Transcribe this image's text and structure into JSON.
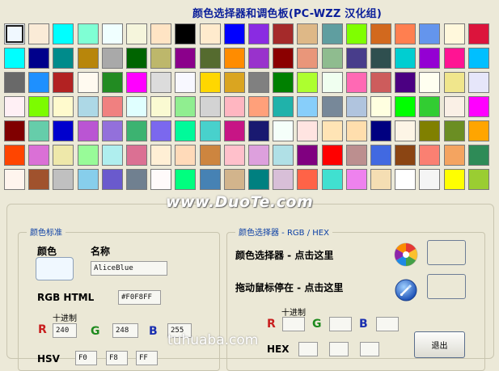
{
  "title": "颜色选择器和调色板(PC-WZZ 汉化组)",
  "watermark": "www.DuoTe.com",
  "corner_watermark": "tuhuaba.com",
  "palette": [
    [
      "#f0f8ff",
      "#faebd7",
      "#00ffff",
      "#7fffd4",
      "#f0ffff",
      "#f5f5dc",
      "#ffe4c4",
      "#000000",
      "#ffebcd",
      "#0000ff",
      "#8a2be2",
      "#a52a2a",
      "#deb887",
      "#5f9ea0",
      "#7fff00",
      "#d2691e",
      "#ff7f50",
      "#6495ed",
      "#fff8dc",
      "#dc143c"
    ],
    [
      "#00ffff",
      "#00008b",
      "#008b8b",
      "#b8860b",
      "#a9a9a9",
      "#006400",
      "#bdb76b",
      "#8b008b",
      "#556b2f",
      "#ff8c00",
      "#9932cc",
      "#8b0000",
      "#e9967a",
      "#8fbc8f",
      "#483d8b",
      "#2f4f4f",
      "#00ced1",
      "#9400d3",
      "#ff1493",
      "#00bfff"
    ],
    [
      "#696969",
      "#1e90ff",
      "#b22222",
      "#fffaf0",
      "#228b22",
      "#ff00ff",
      "#dcdcdc",
      "#f8f8ff",
      "#ffd700",
      "#daa520",
      "#808080",
      "#008000",
      "#adff2f",
      "#f0fff0",
      "#ff69b4",
      "#cd5c5c",
      "#4b0082",
      "#fffff0",
      "#f0e68c",
      "#e6e6fa"
    ],
    [
      "#fff0f5",
      "#7cfc00",
      "#fffacd",
      "#add8e6",
      "#f08080",
      "#e0ffff",
      "#fafad2",
      "#90ee90",
      "#d3d3d3",
      "#ffb6c1",
      "#ffa07a",
      "#20b2aa",
      "#87cefa",
      "#778899",
      "#b0c4de",
      "#ffffe0",
      "#00ff00",
      "#32cd32",
      "#faf0e6",
      "#ff00ff"
    ],
    [
      "#800000",
      "#66cdaa",
      "#0000cd",
      "#ba55d3",
      "#9370db",
      "#3cb371",
      "#7b68ee",
      "#00fa9a",
      "#48d1cc",
      "#c71585",
      "#191970",
      "#f5fffa",
      "#ffe4e1",
      "#ffe4b5",
      "#ffdead",
      "#000080",
      "#fdf5e6",
      "#808000",
      "#6b8e23",
      "#ffa500"
    ],
    [
      "#ff4500",
      "#da70d6",
      "#eee8aa",
      "#98fb98",
      "#afeeee",
      "#db7093",
      "#ffefd5",
      "#ffdab9",
      "#cd853f",
      "#ffc0cb",
      "#dda0dd",
      "#b0e0e6",
      "#800080",
      "#ff0000",
      "#bc8f8f",
      "#4169e1",
      "#8b4513",
      "#fa8072",
      "#f4a460",
      "#2e8b57"
    ],
    [
      "#fff5ee",
      "#a0522d",
      "#c0c0c0",
      "#87ceeb",
      "#6a5acd",
      "#708090",
      "#fffafa",
      "#00ff7f",
      "#4682b4",
      "#d2b48c",
      "#008080",
      "#d8bfd8",
      "#ff6347",
      "#40e0d0",
      "#ee82ee",
      "#f5deb3",
      "#ffffff",
      "#f5f5f5",
      "#ffff00",
      "#9acd32"
    ]
  ],
  "left_group": {
    "title": "颜色标准",
    "color_label": "颜色",
    "name_label": "名称",
    "name_value": "AliceBlue",
    "preview_color": "#f0f8ff",
    "rgb_html_label": "RGB HTML",
    "rgb_html_value": "#F0F8FF",
    "decimal_label": "十进制",
    "r_label": "R",
    "r_value": "240",
    "g_label": "G",
    "g_value": "248",
    "b_label": "B",
    "b_value": "255",
    "hsv_label": "HSV",
    "h_value": "F0",
    "s_value": "F8",
    "v_value": "FF"
  },
  "right_group": {
    "title": "颜色选择器 - RGB / HEX",
    "picker_label": "颜色选择器 - 点击这里",
    "drag_label": "拖动鼠标停在 - 点击这里",
    "picker_icon": "color-wheel-icon",
    "drag_icon": "eyedropper-icon",
    "decimal_label": "十进制",
    "r_label": "R",
    "g_label": "G",
    "b_label": "B",
    "hex_label": "HEX",
    "exit_label": "退出"
  }
}
